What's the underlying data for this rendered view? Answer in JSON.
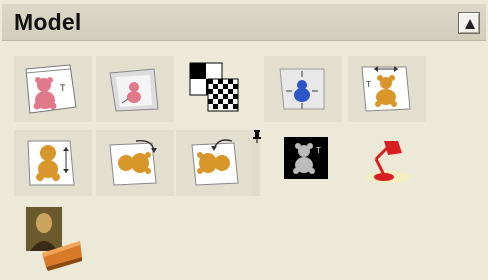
{
  "panel": {
    "title": "Model",
    "collapse_icon": "triangle-up-icon"
  },
  "tools": [
    {
      "id": "bear-document",
      "icon": "bear-document-icon"
    },
    {
      "id": "bear-tilted-document",
      "icon": "bear-document-tilted-icon"
    },
    {
      "id": "checker-swap",
      "icon": "checkerboard-icon"
    },
    {
      "id": "blue-bear-move",
      "icon": "move-arrows-icon"
    },
    {
      "id": "bear-scale",
      "icon": "scale-arrows-icon"
    },
    {
      "id": "bear-flip-vertical",
      "icon": "flip-vertical-icon"
    },
    {
      "id": "bear-rotate-cw",
      "icon": "rotate-cw-icon"
    },
    {
      "id": "bear-rotate-ccw",
      "icon": "rotate-ccw-icon"
    },
    {
      "id": "bear-grayscale",
      "icon": "grayscale-bear-icon"
    },
    {
      "id": "lamp",
      "icon": "desk-lamp-icon"
    },
    {
      "id": "mona-lisa-book",
      "icon": "portrait-book-icon"
    }
  ],
  "colors": {
    "panel_bg": "#ece9d8",
    "header_bg": "#d6d2c0",
    "bear": "#d9962a",
    "pink_bear": "#e07a8a",
    "lamp_red": "#d81f1f"
  }
}
